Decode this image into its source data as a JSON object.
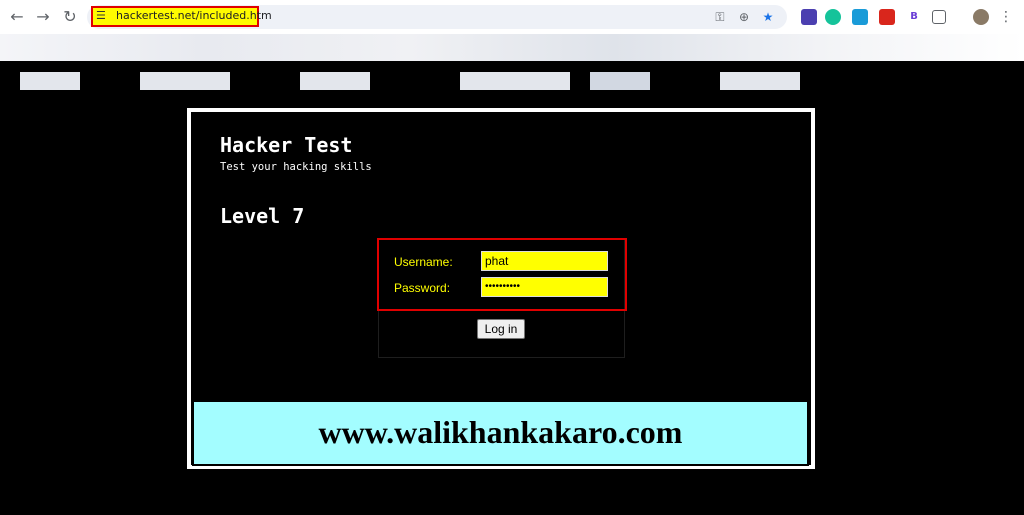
{
  "browser": {
    "url": "hackertest.net/included.htm",
    "icons": {
      "back": "back-arrow-icon",
      "forward": "forward-arrow-icon",
      "reload": "reload-icon",
      "site_info": "site-settings-icon",
      "key": "password-key-icon",
      "zoom": "zoom-icon",
      "bookmark": "star-icon"
    },
    "extensions": [
      "extension-1",
      "grammarly-icon",
      "mail-extension-icon",
      "pdf-icon",
      "bold-icon",
      "puzzle-icon"
    ],
    "extension_labels": {
      "bold": "B"
    }
  },
  "page": {
    "title": "Hacker Test",
    "subtitle": "Test your hacking skills",
    "level": "Level 7",
    "form": {
      "username_label": "Username:",
      "username_value": "phat",
      "password_label": "Password:",
      "password_value": "••••••••••",
      "login_label": "Log in"
    },
    "banner": "www.walikhankakaro.com"
  },
  "colors": {
    "background": "#000000",
    "field": "#ffff00",
    "label": "#ffff00",
    "highlight_border": "#e00000",
    "banner": "#a3fdff"
  }
}
